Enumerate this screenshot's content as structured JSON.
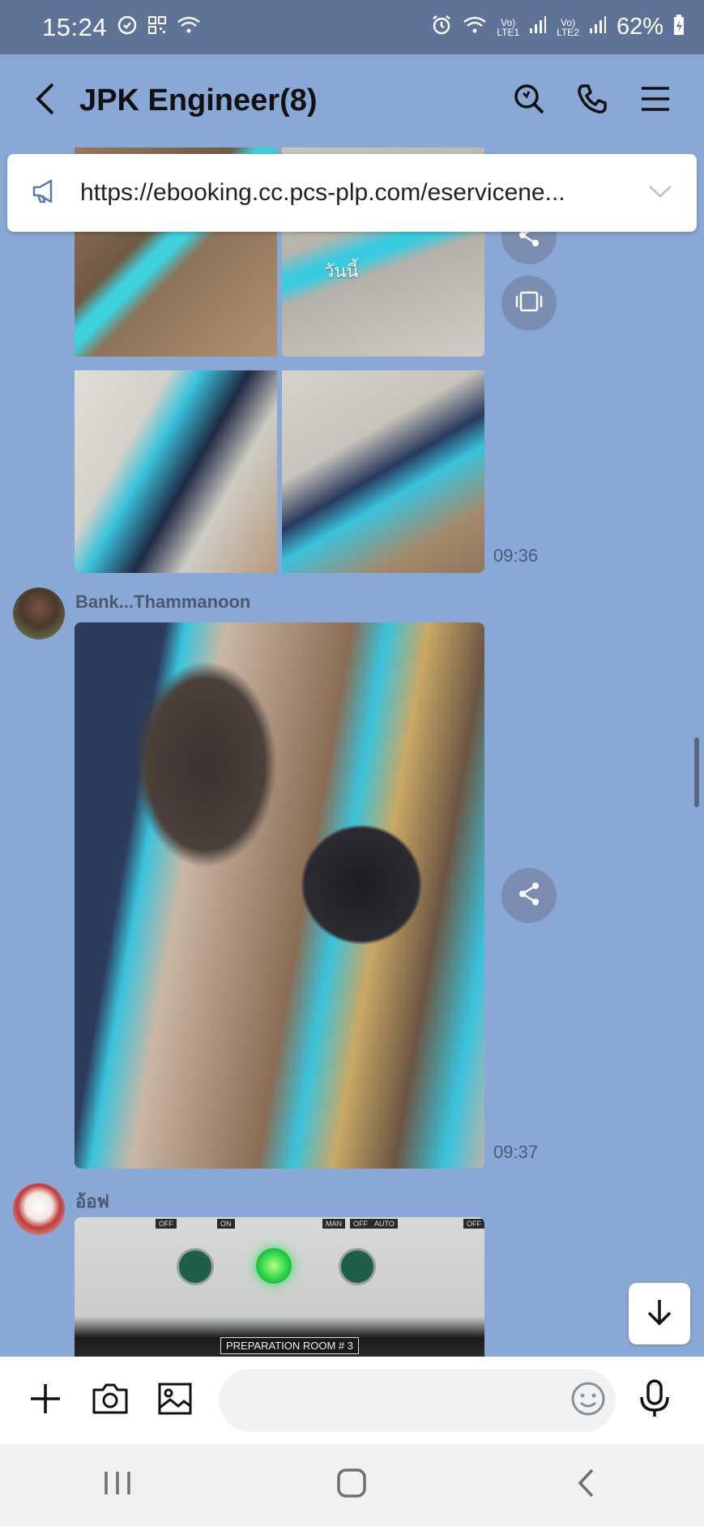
{
  "status_bar": {
    "time": "15:24",
    "battery": "62%",
    "lte1": "Vo)\nLTE1",
    "lte2": "Vo)\nLTE2",
    "icons": [
      "sync-icon",
      "qr-icon",
      "wifi-icon",
      "alarm-icon",
      "wifi-calling-icon",
      "signal-icon",
      "signal-icon",
      "battery-icon"
    ]
  },
  "header": {
    "title": "JPK Engineer(8)",
    "icons": [
      "back-arrow-icon",
      "search-icon",
      "phone-icon",
      "menu-icon"
    ]
  },
  "announcement": {
    "text": "https://ebooking.cc.pcs-plp.com/eservicene..."
  },
  "messages": [
    {
      "type": "photo_grid",
      "overlay_text": "วันนี้",
      "time": "09:36"
    },
    {
      "type": "photo",
      "sender": "Bank...Thammanoon",
      "time": "09:37"
    },
    {
      "type": "photo",
      "sender": "อ้อฟ",
      "caption": "PREPARATION ROOM # 3",
      "panel_labels": [
        "OFF",
        "ON",
        "MAN",
        "OFF",
        "AUTO",
        "OFF"
      ]
    }
  ],
  "input": {
    "placeholder": ""
  },
  "colors": {
    "chat_bg": "#8aa8d6",
    "status_bg": "#5f7398",
    "accent": "#3ac3dc"
  }
}
